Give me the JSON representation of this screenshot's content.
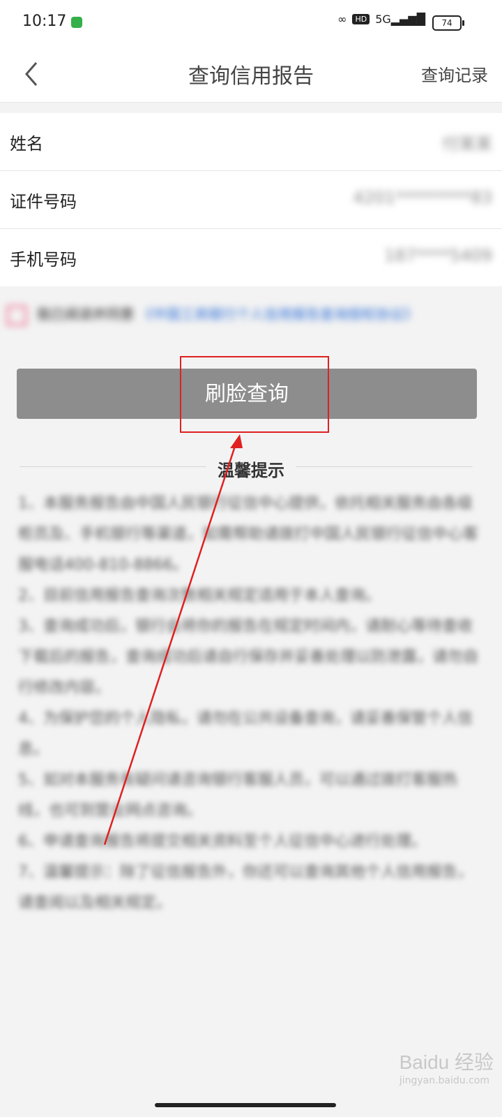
{
  "status": {
    "time": "10:17",
    "hd": "HD",
    "net": "5G",
    "battery": "74"
  },
  "nav": {
    "title": "查询信用报告",
    "right_link": "查询记录"
  },
  "form": {
    "name_label": "姓名",
    "name_value": "付某某",
    "id_label": "证件号码",
    "id_value": "4201*********83",
    "phone_label": "手机号码",
    "phone_value": "187****5409"
  },
  "agreement": {
    "text": "我已阅读并同意",
    "link": "《中国工商银行个人信用报告查询授权协议》"
  },
  "face_button": "刷脸查询",
  "tips_title": "温馨提示",
  "tips": [
    "1、本服务报告由中国人民银行征信中心提供，依托相关服务由各级柜员及、手机银行等渠道，如需帮助请拨打中国人民银行征信中心客服电话400-810-8866。",
    "2、目前信用报告查询次数相关规定适用于本人查询。",
    "3、查询成功后，银行会将你的报告在规定时间内，请耐心等待查收下载后的报告，查询成功后请自行保存并妥善处理以防泄露，请勿自行修改内容。",
    "4、为保护您的个人隐私，请勿在公共设备查询，请妥善保管个人信息。",
    "5、如对本服务有疑问请咨询银行客服人员，可以通过拨打客服热线，也可到营业网点咨询。",
    "6、申请查询报告将提交相关资料至个人征信中心进行处理。",
    "7、温馨提示：除了征信报告外，你还可以查询其他个人信用报告，请查阅以及相关规定。"
  ],
  "watermark": "Baidu 经验",
  "watermark_sub": "jingyan.baidu.com"
}
